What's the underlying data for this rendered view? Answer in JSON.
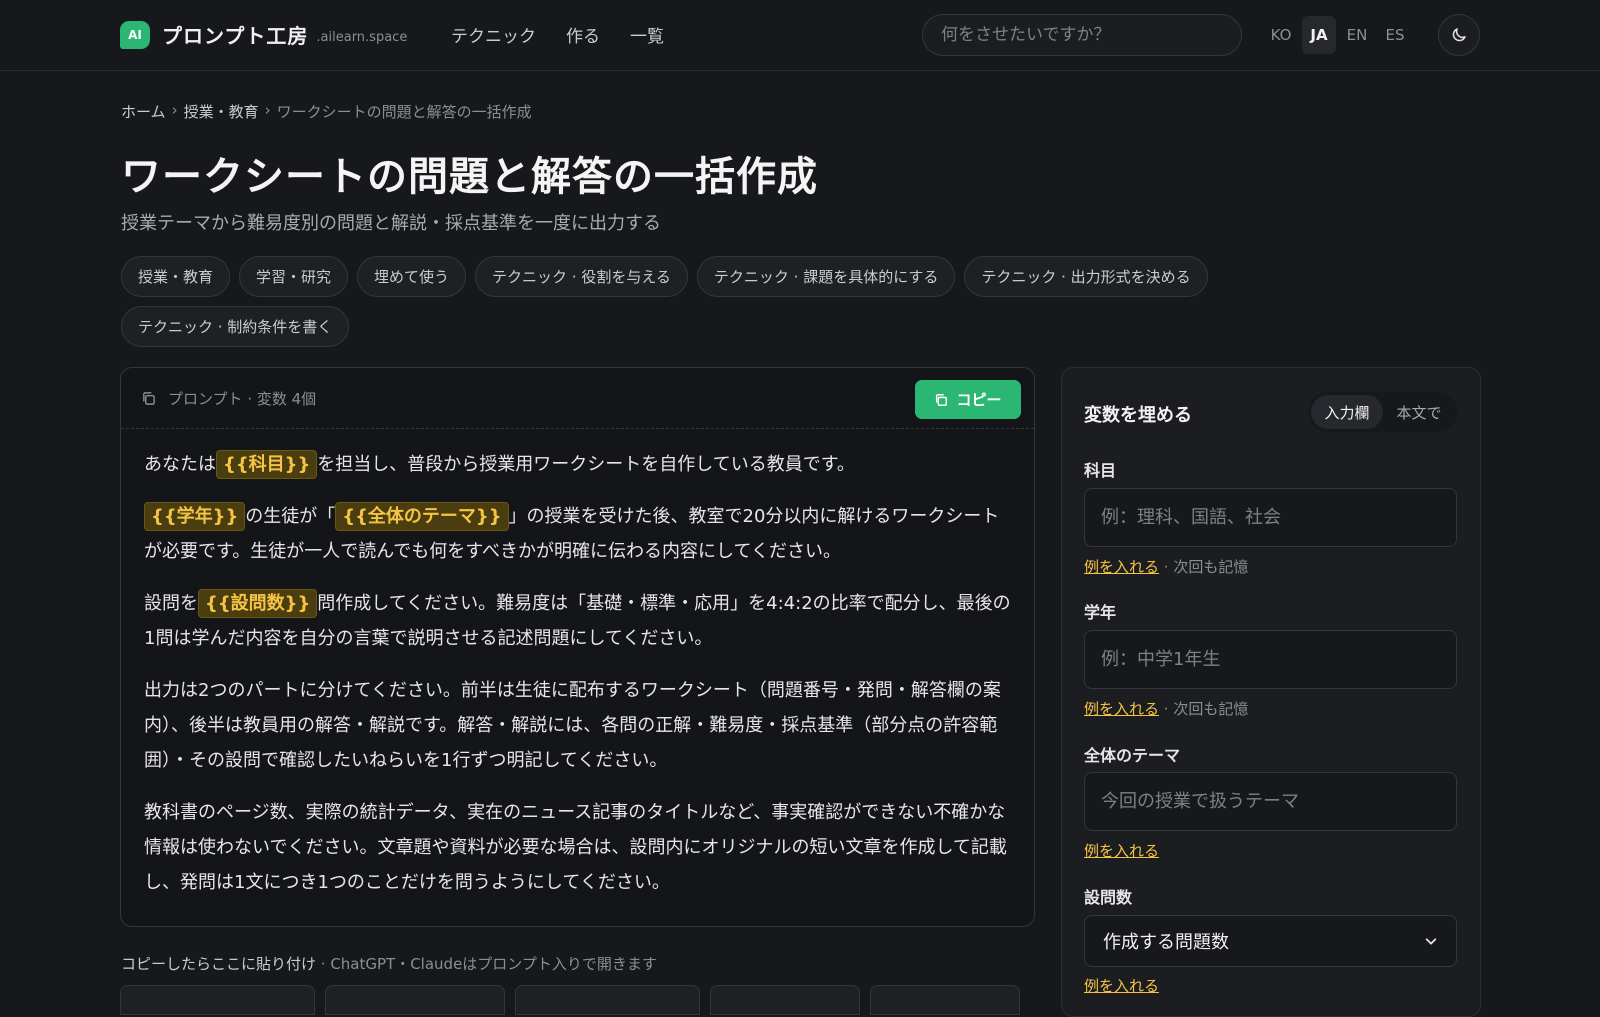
{
  "header": {
    "logo_badge": "AI",
    "logo_name": "プロンプト工房",
    "logo_domain": ".ailearn.space",
    "nav": [
      "テクニック",
      "作る",
      "一覧"
    ],
    "search_placeholder": "何をさせたいですか？",
    "languages": [
      "KO",
      "JA",
      "EN",
      "ES"
    ],
    "active_language": "JA"
  },
  "breadcrumb": {
    "home": "ホーム",
    "category": "授業・教育",
    "current": "ワークシートの問題と解答の一括作成",
    "sep": "›"
  },
  "page": {
    "title": "ワークシートの問題と解答の一括作成",
    "subtitle": "授業テーマから難易度別の問題と解説・採点基準を一度に出力する"
  },
  "tags": [
    "授業・教育",
    "学習・研究",
    "埋めて使う",
    "テクニック · 役割を与える",
    "テクニック · 課題を具体的にする",
    "テクニック · 出力形式を決める",
    "テクニック · 制約条件を書く"
  ],
  "prompt_card": {
    "header_label": "プロンプト · 変数 4個",
    "copy_label": "コピー",
    "p1": {
      "a": "あなたは",
      "v1": "{{科目}}",
      "b": "を担当し、普段から授業用ワークシートを自作している教員です。"
    },
    "p2": {
      "v1": "{{学年}}",
      "a": "の生徒が「",
      "v2": "{{全体のテーマ}}",
      "b": "」の授業を受けた後、教室で20分以内に解けるワークシートが必要です。生徒が一人で読んでも何をすべきかが明確に伝わる内容にしてください。"
    },
    "p3": {
      "a": "設問を",
      "v1": "{{設問数}}",
      "b": "問作成してください。難易度は「基礎・標準・応用」を4:4:2の比率で配分し、最後の1問は学んだ内容を自分の言葉で説明させる記述問題にしてください。"
    },
    "p4": "出力は2つのパートに分けてください。前半は生徒に配布するワークシート（問題番号・発問・解答欄の案内）、後半は教員用の解答・解説です。解答・解説には、各問の正解・難易度・採点基準（部分点の許容範囲）・その設問で確認したいねらいを1行ずつ明記してください。",
    "p5": "教科書のページ数、実際の統計データ、実在のニュース記事のタイトルなど、事実確認ができない不確かな情報は使わないでください。文章題や資料が必要な場合は、設問内にオリジナルの短い文章を作成して記載し、発問は1文につき1つのことだけを問うようにしてください。"
  },
  "paste_hint": {
    "main": "コピーしたらここに貼り付け",
    "sub": " · ChatGPT・Claudeはプロンプト入りで開きます"
  },
  "panel": {
    "title": "変数を埋める",
    "toggle": [
      "入力欄",
      "本文で"
    ],
    "fields": [
      {
        "label": "科目",
        "placeholder": "例：理科、国語、社会",
        "example": "例を入れる",
        "remember": " · 次回も記憶"
      },
      {
        "label": "学年",
        "placeholder": "例：中学1年生",
        "example": "例を入れる",
        "remember": " · 次回も記憶"
      },
      {
        "label": "全体のテーマ",
        "placeholder": "今回の授業で扱うテーマ",
        "example": "例を入れる"
      },
      {
        "label": "設問数",
        "selected": "作成する問題数",
        "example": "例を入れる"
      }
    ]
  },
  "colors": {
    "accent": "#2bb673",
    "variable": "#f5c443",
    "background": "#17181b"
  }
}
